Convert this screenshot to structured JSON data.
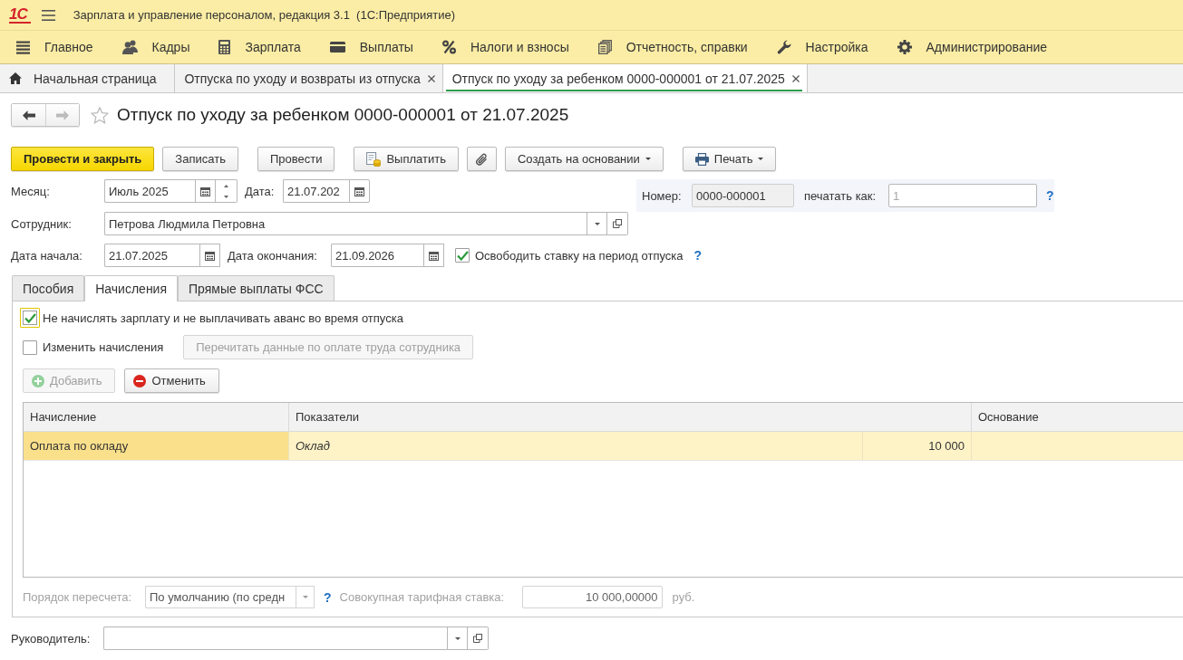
{
  "window": {
    "logo": "1С",
    "title": "Зарплата и управление персоналом, редакция 3.1  (1С:Предприятие)"
  },
  "sections": [
    {
      "label": "Главное"
    },
    {
      "label": "Кадры"
    },
    {
      "label": "Зарплата"
    },
    {
      "label": "Выплаты"
    },
    {
      "label": "Налоги и взносы"
    },
    {
      "label": "Отчетность, справки"
    },
    {
      "label": "Настройка"
    },
    {
      "label": "Администрирование"
    }
  ],
  "open_tabs": [
    {
      "label": "Начальная страница",
      "kind": "home",
      "selected": false
    },
    {
      "label": "Отпуска по уходу и возвраты из отпуска",
      "kind": "document",
      "selected": false
    },
    {
      "label": "Отпуск по уходу за ребенком 0000-000001 от 21.07.2025",
      "kind": "document",
      "selected": true
    }
  ],
  "navigation": [
    {
      "kind": "back",
      "disabled": false
    },
    {
      "kind": "forward",
      "disabled": true
    }
  ],
  "form": {
    "title": "Отпуск по уходу за ребенком 0000-000001 от 21.07.2025",
    "favorite": false
  },
  "commands": [
    {
      "label": "Провести и закрыть",
      "kind": "primary"
    },
    {
      "label": "Записать",
      "kind": "plain"
    },
    {
      "label": "Провести",
      "kind": "plain"
    },
    {
      "label": "Выплатить",
      "kind": "payout"
    },
    {
      "kind": "attach"
    },
    {
      "label": "Создать на основании",
      "kind": "menu"
    },
    {
      "label": "Печать",
      "kind": "print"
    }
  ],
  "header": {
    "month": {
      "label": "Месяц:",
      "value": "Июль 2025"
    },
    "date": {
      "label": "Дата:",
      "value": "21.07.202"
    },
    "number": {
      "label": "Номер:",
      "value": "0000-000001"
    },
    "print_as": {
      "label": "печатать как:",
      "placeholder": "1",
      "help": "?"
    },
    "employee": {
      "label": "Сотрудник:",
      "value": "Петрова Людмила Петровна"
    },
    "start_date": {
      "label": "Дата начала:",
      "value": "21.07.2025"
    },
    "end_date": {
      "label": "Дата окончания:",
      "value": "21.09.2026"
    },
    "release_rate": {
      "label": "Освободить ставку на период отпуска",
      "checked": true,
      "help": "?"
    }
  },
  "tabs": [
    {
      "label": "Пособия",
      "selected": false
    },
    {
      "label": "Начисления",
      "selected": true
    },
    {
      "label": "Прямые выплаты ФСС",
      "selected": false
    }
  ],
  "accruals": {
    "no_salary": {
      "label": "Не начислять зарплату и не выплачивать аванс во время отпуска",
      "checked": true,
      "focused": true
    },
    "change_accruals": {
      "label": "Изменить начисления",
      "checked": false
    },
    "reread_button": {
      "label": "Перечитать данные по оплате труда сотрудника",
      "disabled": true
    },
    "table_buttons": [
      {
        "label": "Добавить",
        "kind": "add",
        "disabled": true
      },
      {
        "label": "Отменить",
        "kind": "cancel",
        "disabled": false
      }
    ],
    "table": {
      "columns": [
        "Начисление",
        "Показатели",
        "Основание"
      ],
      "rows": [
        {
          "accrual": "Оплата по окладу",
          "indicator": "Оклад",
          "amount": "10 000",
          "selected": true
        }
      ]
    },
    "recalc_order": {
      "label": "Порядок пересчета:",
      "value": "По умолчанию (по средн",
      "help": "?",
      "disabled": true
    },
    "total_rate": {
      "label": "Совокупная тарифная ставка:",
      "value": "10 000,00000",
      "unit": "руб.",
      "disabled": true
    }
  },
  "manager": {
    "label": "Руководитель:"
  }
}
